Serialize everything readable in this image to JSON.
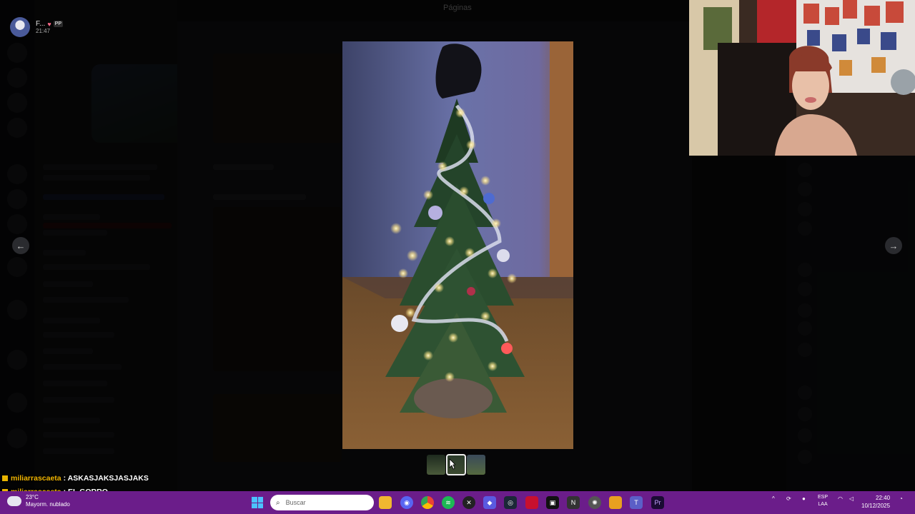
{
  "viewer": {
    "top_title": "Páginas",
    "prev_label": "←",
    "next_label": "→",
    "thumbnails": 3
  },
  "user": {
    "name": "F...",
    "badge": "PP",
    "time": "21:47"
  },
  "chat": {
    "messages": [
      {
        "user": "miliarrascaeta",
        "text": ": ASKASJAKSJASJAKS"
      },
      {
        "user": "miliarrascaeta",
        "text": ": EL GORRO"
      }
    ]
  },
  "taskbar": {
    "weather_temp": "23°C",
    "weather_desc": "Mayorm. nublado",
    "search_placeholder": "Buscar",
    "lang_top": "ESP",
    "lang_bottom": "LAA",
    "time": "22:40",
    "date": "10/12/2025",
    "colors": {
      "taskbar": "#6b1d8a",
      "accent": "#4cc2ff"
    }
  }
}
